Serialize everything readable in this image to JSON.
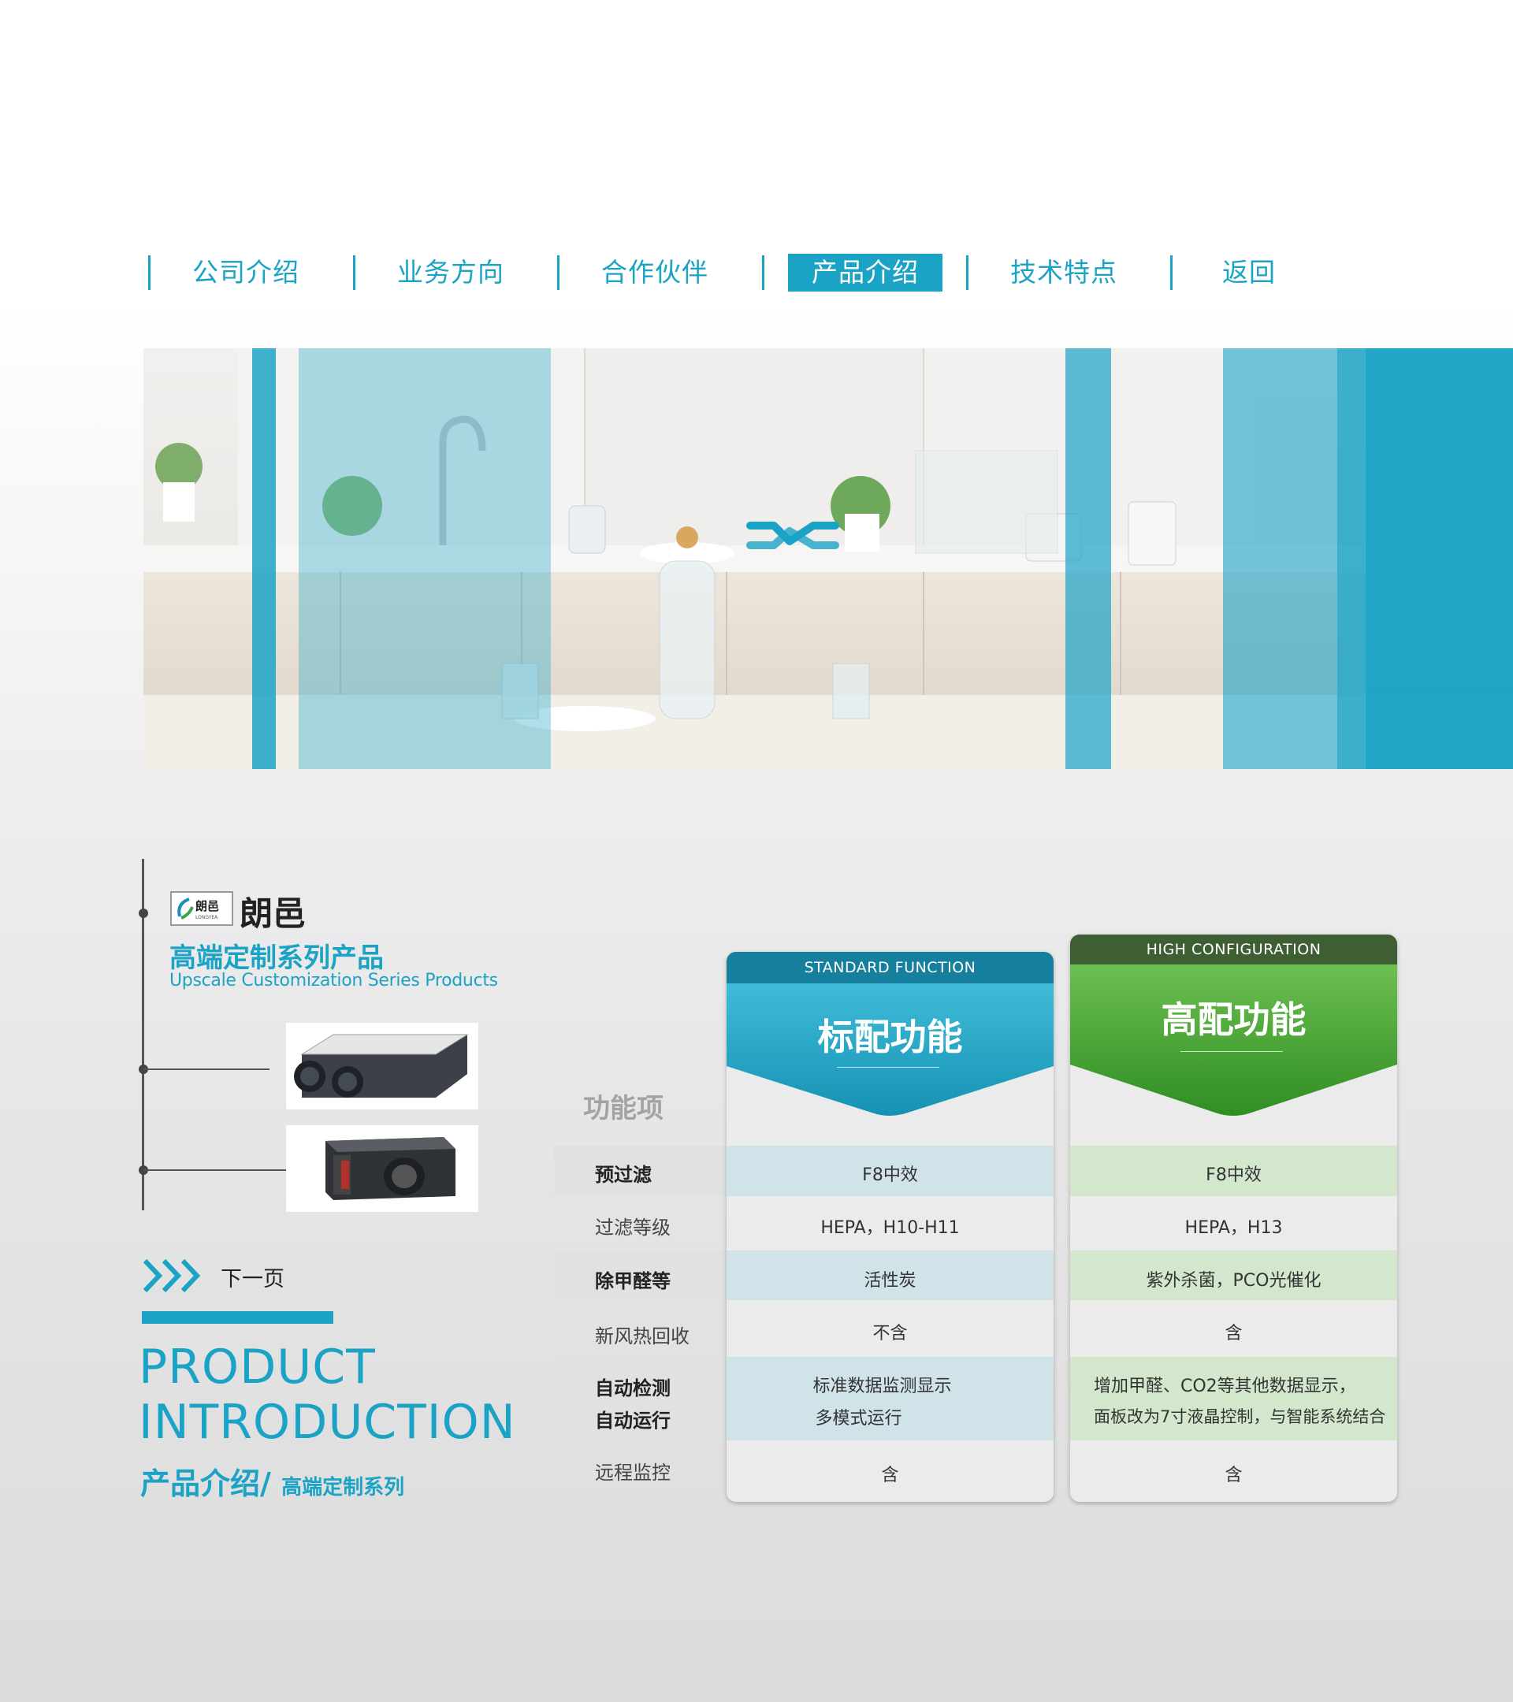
{
  "nav": {
    "items": [
      "公司介绍",
      "业务方向",
      "合作伙伴",
      "产品介绍",
      "技术特点",
      "返回"
    ],
    "active_index": 3
  },
  "brand": {
    "logo_text": "朗邑",
    "logo_subtext": "LONGYEA",
    "name": "朗邑",
    "series_cn": "高端定制系列产品",
    "series_en": "Upscale Customization Series Products"
  },
  "next": {
    "label": "下一页"
  },
  "product_intro": {
    "en_line1": "PRODUCT",
    "en_line2": "INTRODUCTION",
    "cn_main": "产品介绍/",
    "cn_sub": "高端定制系列"
  },
  "table": {
    "feature_header": "功能项",
    "standard": {
      "strip": "STANDARD FUNCTION",
      "title": "标配功能"
    },
    "high": {
      "strip": "HIGH CONFIGURATION",
      "title": "高配功能"
    },
    "rows": [
      {
        "label": "预过滤",
        "standard": "F8中效",
        "high": "F8中效"
      },
      {
        "label": "过滤等级",
        "standard": "HEPA，H10-H11",
        "high": "HEPA，H13"
      },
      {
        "label": "除甲醛等",
        "standard": "活性炭",
        "high": "紫外杀菌，PCO光催化"
      },
      {
        "label": "新风热回收",
        "standard": "不含",
        "high": "含"
      },
      {
        "label": "自动检测",
        "label2": "自动运行",
        "standard": "标准数据监测显示",
        "standard2": "多模式运行",
        "high": "增加甲醛、CO2等其他数据显示，",
        "high2": "面板改为7寸液晶控制，与智能系统结合"
      },
      {
        "label": "远程监控",
        "standard": "含",
        "high": "含"
      }
    ]
  },
  "colors": {
    "accent": "#1ba3c6",
    "standard_band": "#cfe3e9",
    "high_band": "#d3e7cd",
    "high_green": "#3f9a2a"
  }
}
